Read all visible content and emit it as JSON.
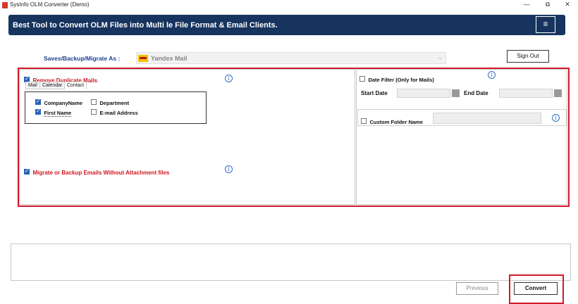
{
  "window": {
    "title": "SysInfo OLM Converter (Demo)",
    "minimize": "—",
    "maximize": "⧉",
    "close": "✕"
  },
  "banner": {
    "text": "Best Tool to Convert OLM Files into Multi le File Format & Email Clients.",
    "menu_icon": "≡"
  },
  "save_as": {
    "label": "Saves/Backup/Migrate As :",
    "selected": "Yandex Mail"
  },
  "sign_out": "Sign Out",
  "left_pane": {
    "remove_duplicates": {
      "label": "Remove Duplicate Mails",
      "checked": true
    },
    "tabs": [
      "Mail",
      "Calendar",
      "Contact"
    ],
    "active_tab": "Contact",
    "contact_fields": [
      {
        "label": "CompanyName",
        "checked": true
      },
      {
        "label": "Department",
        "checked": false
      },
      {
        "label": "First Name",
        "checked": true
      },
      {
        "label": "E-mail Address",
        "checked": false
      }
    ],
    "without_attachment": {
      "label": "Migrate or Backup Emails Without Attachment files",
      "checked": true
    }
  },
  "right_pane": {
    "date_filter": {
      "label": "Date Filter  (Only for Mails)",
      "checked": false
    },
    "start_date_label": "Start Date",
    "end_date_label": "End Date",
    "custom_folder": {
      "label": "Custom Folder Name",
      "checked": false
    }
  },
  "buttons": {
    "previous": "Previous",
    "convert": "Convert"
  },
  "colors": {
    "banner": "#16345e",
    "highlight": "#d01a2a",
    "label_blue": "#1c3f8f",
    "red_text": "#d0161e"
  }
}
